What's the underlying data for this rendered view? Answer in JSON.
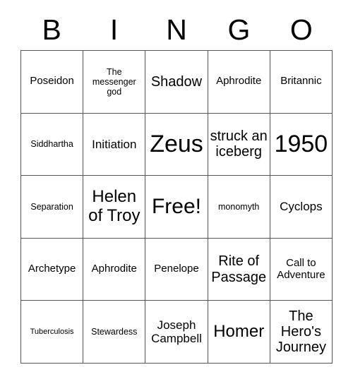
{
  "card": {
    "header_letters": [
      "B",
      "I",
      "N",
      "G",
      "O"
    ],
    "columns": 5,
    "rows": 5,
    "border_color": "#555555",
    "background_color": "#ffffff",
    "text_color": "#000000",
    "cells": [
      [
        {
          "text": "Poseidon",
          "size": "md"
        },
        {
          "text": "The messenger god",
          "size": "sm"
        },
        {
          "text": "Shadow",
          "size": "xl"
        },
        {
          "text": "Aphrodite",
          "size": "md"
        },
        {
          "text": "Britannic",
          "size": "md"
        }
      ],
      [
        {
          "text": "Siddhartha",
          "size": "sm"
        },
        {
          "text": "Initiation",
          "size": "lg"
        },
        {
          "text": "Zeus",
          "size": "4xl"
        },
        {
          "text": "struck an iceberg",
          "size": "xl"
        },
        {
          "text": "1950",
          "size": "4xl"
        }
      ],
      [
        {
          "text": "Separation",
          "size": "sm"
        },
        {
          "text": "Helen of Troy",
          "size": "2xl"
        },
        {
          "text": "Free!",
          "size": "3xl"
        },
        {
          "text": "monomyth",
          "size": "sm"
        },
        {
          "text": "Cyclops",
          "size": "lg"
        }
      ],
      [
        {
          "text": "Archetype",
          "size": "md"
        },
        {
          "text": "Aphrodite",
          "size": "md"
        },
        {
          "text": "Penelope",
          "size": "md"
        },
        {
          "text": "Rite of Passage",
          "size": "xl"
        },
        {
          "text": "Call to Adventure",
          "size": "md"
        }
      ],
      [
        {
          "text": "Tuberculosis",
          "size": "xs"
        },
        {
          "text": "Stewardess",
          "size": "sm"
        },
        {
          "text": "Joseph Campbell",
          "size": "lg"
        },
        {
          "text": "Homer",
          "size": "2xl"
        },
        {
          "text": "The Hero's Journey",
          "size": "xl"
        }
      ]
    ]
  }
}
